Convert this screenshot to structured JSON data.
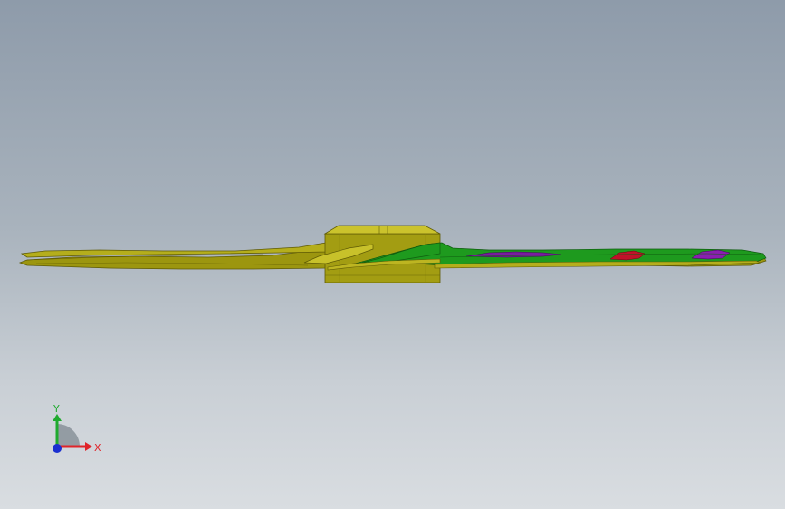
{
  "viewport": {
    "background_top": "#8e9baa",
    "background_bottom": "#d9dde1"
  },
  "model": {
    "icon": "propeller-fan-model",
    "colors": {
      "base": "#a9a315",
      "base_dark": "#7c7808",
      "base_light": "#c8c12a",
      "green": "#1e9a1e",
      "purple": "#8a1fb0",
      "red": "#c0122a"
    }
  },
  "triad": {
    "x_label": "X",
    "y_label": "Y",
    "x_color": "#e0242a",
    "y_color": "#1faa2e",
    "z_color": "#1a2fd0"
  }
}
